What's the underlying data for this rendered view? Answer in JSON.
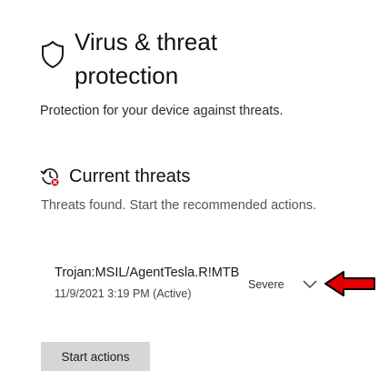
{
  "page": {
    "title_line1": "Virus & threat",
    "title_line2": "protection",
    "subtitle": "Protection for your device against threats.",
    "icon": "shield-icon"
  },
  "current_threats": {
    "heading": "Current threats",
    "icon": "threat-history-icon",
    "description": "Threats found. Start the recommended actions.",
    "threats": [
      {
        "name": "Trojan:MSIL/AgentTesla.R!MTB",
        "detected": "11/9/2021 3:19 PM (Active)",
        "severity": "Severe",
        "expand_icon": "chevron-down-icon"
      }
    ],
    "action_button": "Start actions"
  },
  "annotation": {
    "icon": "red-arrow-icon",
    "color": "#e00000"
  }
}
